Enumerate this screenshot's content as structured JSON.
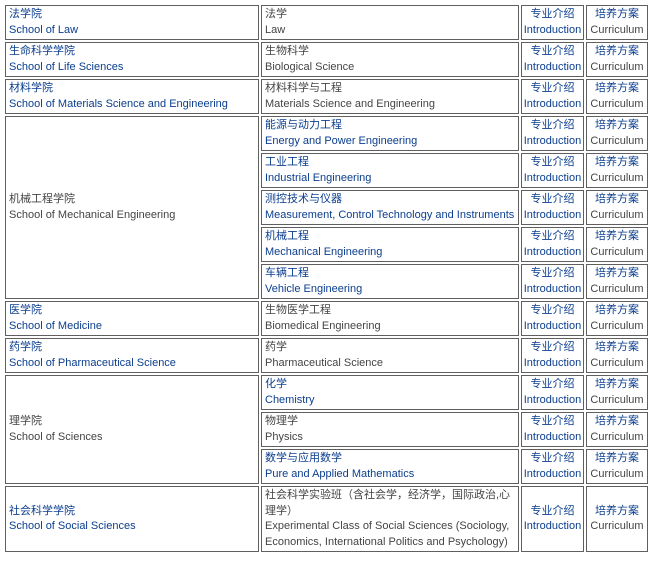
{
  "buttons": {
    "intro_cn": "专业介绍",
    "intro_en": "Introduction",
    "cur_cn": "培养方案",
    "cur_en": "Curriculum"
  },
  "schools": [
    {
      "cn": "法学院",
      "en": "School of Law",
      "link": true,
      "majors": [
        {
          "cn": "法学",
          "en": "Law",
          "link": false
        }
      ]
    },
    {
      "cn": "生命科学学院",
      "en": "School of Life Sciences",
      "link": true,
      "majors": [
        {
          "cn": "生物科学",
          "en": "Biological Science",
          "link": false
        }
      ]
    },
    {
      "cn": "材料学院",
      "en": "School of Materials Science and Engineering",
      "link": true,
      "majors": [
        {
          "cn": "材料科学与工程",
          "en": "Materials Science and Engineering",
          "link": false
        }
      ]
    },
    {
      "cn": "机械工程学院",
      "en": "School of Mechanical Engineering",
      "link": false,
      "majors": [
        {
          "cn": "能源与动力工程",
          "en": "Energy and Power Engineering",
          "link": true
        },
        {
          "cn": "工业工程",
          "en": "Industrial Engineering",
          "link": true
        },
        {
          "cn": "测控技术与仪器",
          "en": "Measurement, Control Technology and Instruments",
          "link": true
        },
        {
          "cn": "机械工程",
          "en": "Mechanical Engineering",
          "link": true
        },
        {
          "cn": "车辆工程",
          "en": "Vehicle Engineering",
          "link": true
        }
      ]
    },
    {
      "cn": "医学院",
      "en": "School of Medicine",
      "link": true,
      "majors": [
        {
          "cn": "生物医学工程",
          "en": "Biomedical Engineering",
          "link": false
        }
      ]
    },
    {
      "cn": "药学院",
      "en": "School of Pharmaceutical Science",
      "link": true,
      "majors": [
        {
          "cn": "药学",
          "en": "Pharmaceutical Science",
          "link": false
        }
      ]
    },
    {
      "cn": "理学院",
      "en": "School of Sciences",
      "link": false,
      "majors": [
        {
          "cn": "化学",
          "en": "Chemistry",
          "link": true
        },
        {
          "cn": "物理学",
          "en": "Physics",
          "link": false
        },
        {
          "cn": "数学与应用数学",
          "en": "Pure and Applied Mathematics",
          "link": true
        }
      ]
    },
    {
      "cn": "社会科学学院",
      "en": "School of Social Sciences",
      "link": true,
      "majors": [
        {
          "cn": "社会科学实验班（含社会学，经济学，国际政治,心理学）",
          "en": "Experimental Class of Social Sciences (Sociology, Economics, International Politics and Psychology)",
          "link": false,
          "wrap": true
        }
      ]
    }
  ]
}
